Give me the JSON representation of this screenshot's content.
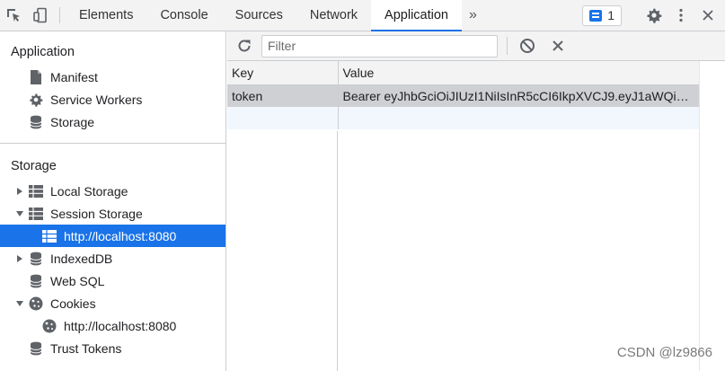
{
  "toolbar": {
    "tabs": [
      {
        "label": "Elements"
      },
      {
        "label": "Console"
      },
      {
        "label": "Sources"
      },
      {
        "label": "Network"
      },
      {
        "label": "Application"
      }
    ],
    "more_tabs_label": "»",
    "issues_count": "1",
    "accent_color": "#1a73e8"
  },
  "sidebar": {
    "application_title": "Application",
    "application_items": [
      {
        "label": "Manifest",
        "icon": "file-icon"
      },
      {
        "label": "Service Workers",
        "icon": "gear-icon"
      },
      {
        "label": "Storage",
        "icon": "database-icon"
      }
    ],
    "storage_title": "Storage",
    "storage_items": [
      {
        "label": "Local Storage",
        "icon": "grid-icon",
        "expanded": false
      },
      {
        "label": "Session Storage",
        "icon": "grid-icon",
        "expanded": true
      },
      {
        "label": "http://localhost:8080",
        "icon": "grid-icon",
        "selected": true
      },
      {
        "label": "IndexedDB",
        "icon": "database-icon",
        "expanded": false
      },
      {
        "label": "Web SQL",
        "icon": "database-icon"
      },
      {
        "label": "Cookies",
        "icon": "cookie-icon",
        "expanded": true
      },
      {
        "label": "http://localhost:8080",
        "icon": "cookie-icon"
      },
      {
        "label": "Trust Tokens",
        "icon": "database-icon"
      }
    ]
  },
  "main": {
    "filter_placeholder": "Filter",
    "columns": [
      "Key",
      "Value"
    ],
    "rows": [
      {
        "key": "token",
        "value": "Bearer eyJhbGciOiJIUzI1NiIsInR5cCI6IkpXVCJ9.eyJ1aWQiOj..."
      }
    ]
  },
  "watermark": "CSDN @lz9866"
}
